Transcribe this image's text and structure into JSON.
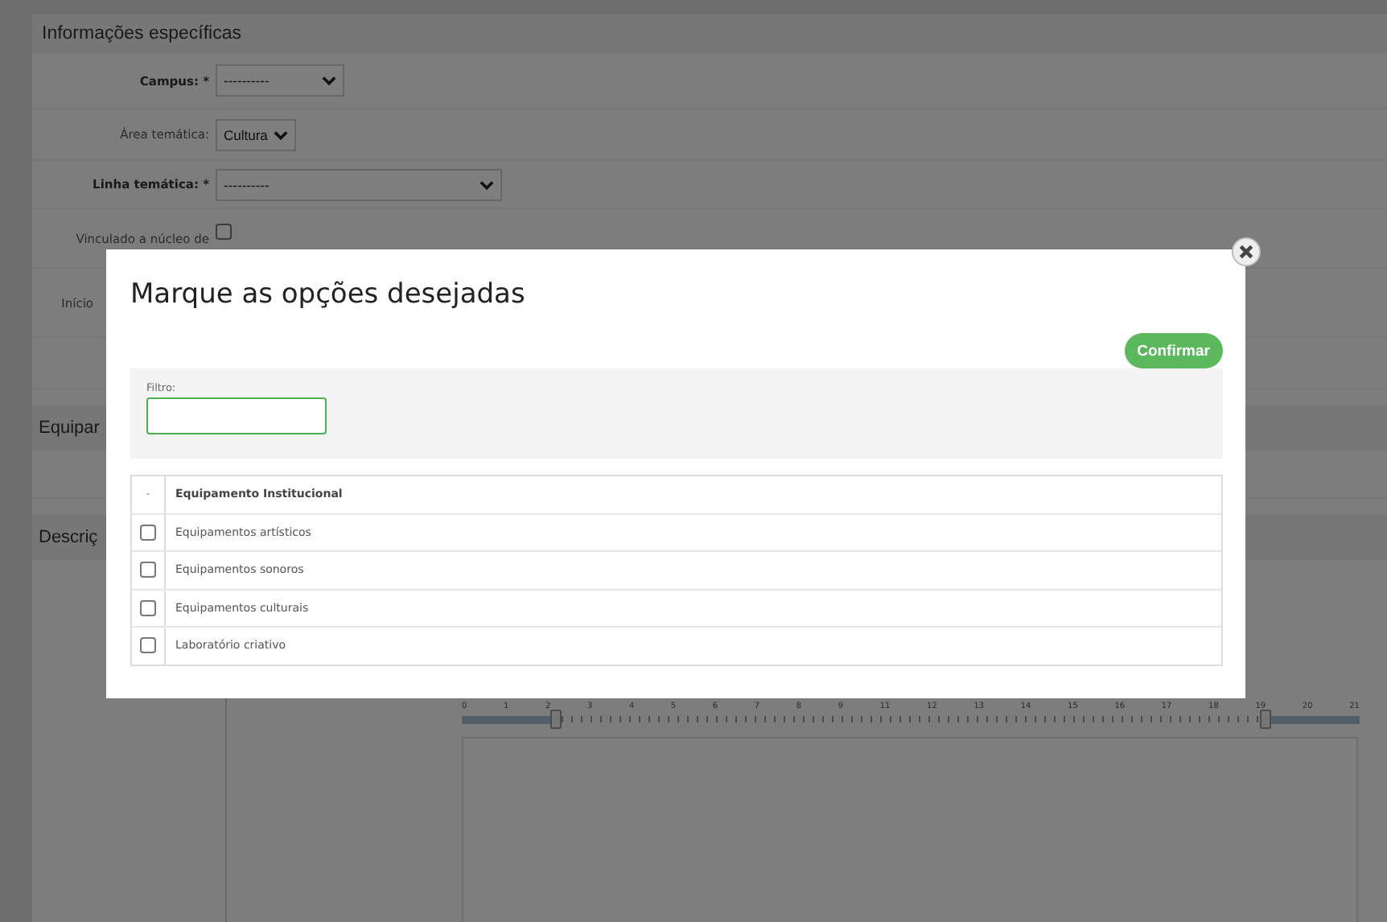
{
  "background_form": {
    "section_title": "Informações específicas",
    "fields": [
      {
        "kind": "select",
        "label": "Campus: *",
        "required": true,
        "value": "----------"
      },
      {
        "kind": "select",
        "label": "Área temática:",
        "required": false,
        "value": "Cultura"
      },
      {
        "kind": "select",
        "label": "Linha temática: *",
        "required": true,
        "value": "----------"
      },
      {
        "kind": "checkbox",
        "label": "Vinculado a núcleo de",
        "checked": false
      },
      {
        "kind": "text",
        "label": "Início"
      },
      {
        "kind": "empty"
      }
    ],
    "section_2_title": "Equipar",
    "section_3_title": "Descriç",
    "ruler": {
      "labels": [
        "0",
        "1",
        "2",
        "3",
        "4",
        "5",
        "6",
        "7",
        "8",
        "9",
        "11",
        "12",
        "13",
        "14",
        "15",
        "16",
        "17",
        "18",
        "19",
        "20",
        "21"
      ]
    }
  },
  "modal": {
    "title": "Marque as opções desejadas",
    "confirm_button": "Confirmar",
    "filter": {
      "label": "Filtro:"
    },
    "table": {
      "columns": [
        "-",
        "Equipamento Institucional"
      ],
      "rows": [
        {
          "label": "Equipamentos artísticos",
          "checked": false
        },
        {
          "label": "Equipamentos sonoros",
          "checked": false
        },
        {
          "label": "Equipamentos culturais",
          "checked": false
        },
        {
          "label": "Laboratório criativo",
          "checked": false
        }
      ]
    }
  }
}
